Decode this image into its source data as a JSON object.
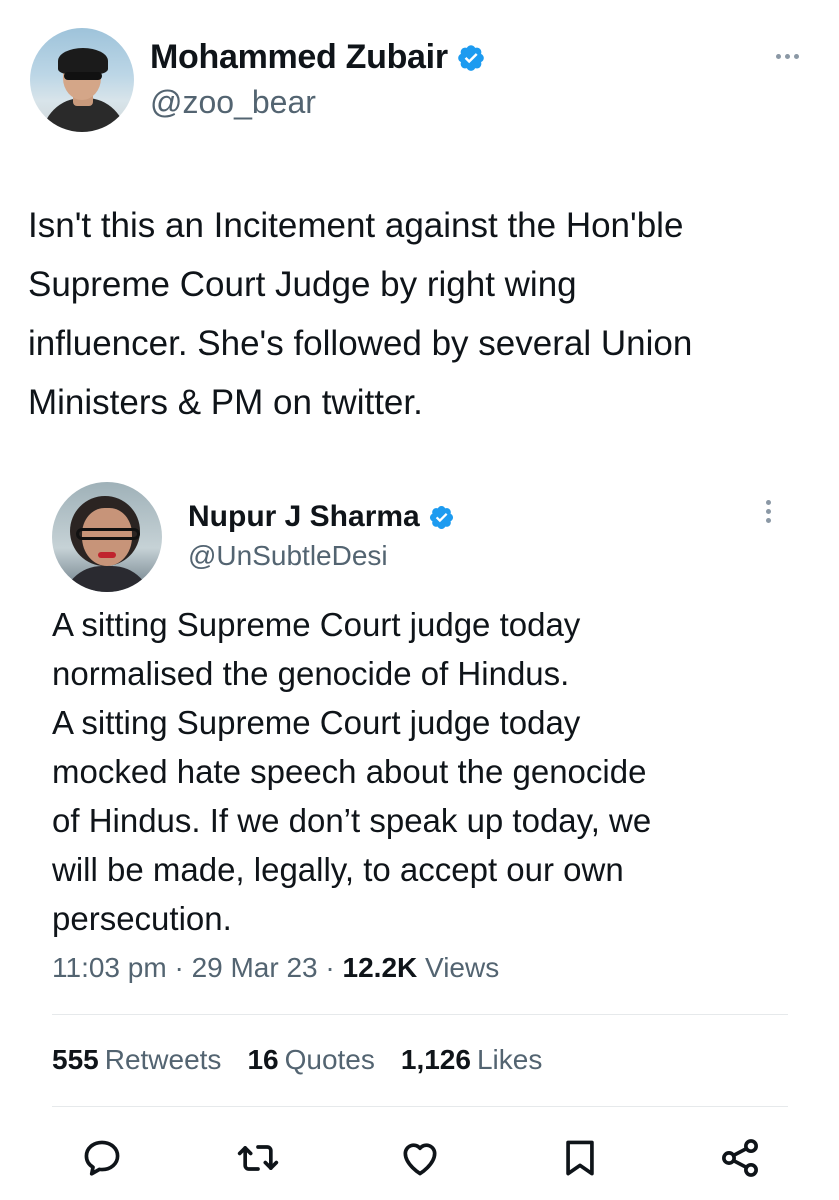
{
  "author": {
    "name": "Mohammed Zubair",
    "handle": "@zoo_bear",
    "verified_color": "#1d9bf0"
  },
  "tweet": {
    "text": "Isn't this an Incitement against the Hon'ble\nSupreme Court Judge by right wing\ninfluencer. She's followed by several Union\nMinisters & PM on twitter."
  },
  "quoted": {
    "name": "Nupur J Sharma",
    "handle": "@UnSubtleDesi",
    "text": "A sitting Supreme Court judge today\nnormalised the genocide of Hindus.\nA sitting Supreme Court judge today\nmocked hate speech about the genocide\nof Hindus. If we don’t speak up today, we\nwill be made, legally, to accept our own\npersecution.",
    "time": "11:03 pm",
    "date": "29 Mar 23",
    "views_count": "12.2K",
    "views_label": "Views",
    "separator": "·"
  },
  "stats": {
    "retweets_count": "555",
    "retweets_label": "Retweets",
    "quotes_count": "16",
    "quotes_label": "Quotes",
    "likes_count": "1,126",
    "likes_label": "Likes"
  },
  "icons": {
    "reply": "reply-icon",
    "retweet": "retweet-icon",
    "like": "like-icon",
    "bookmark": "bookmark-icon",
    "share": "share-icon"
  },
  "colors": {
    "accent": "#1d9bf0",
    "text": "#0f1419",
    "secondary": "#536471"
  }
}
